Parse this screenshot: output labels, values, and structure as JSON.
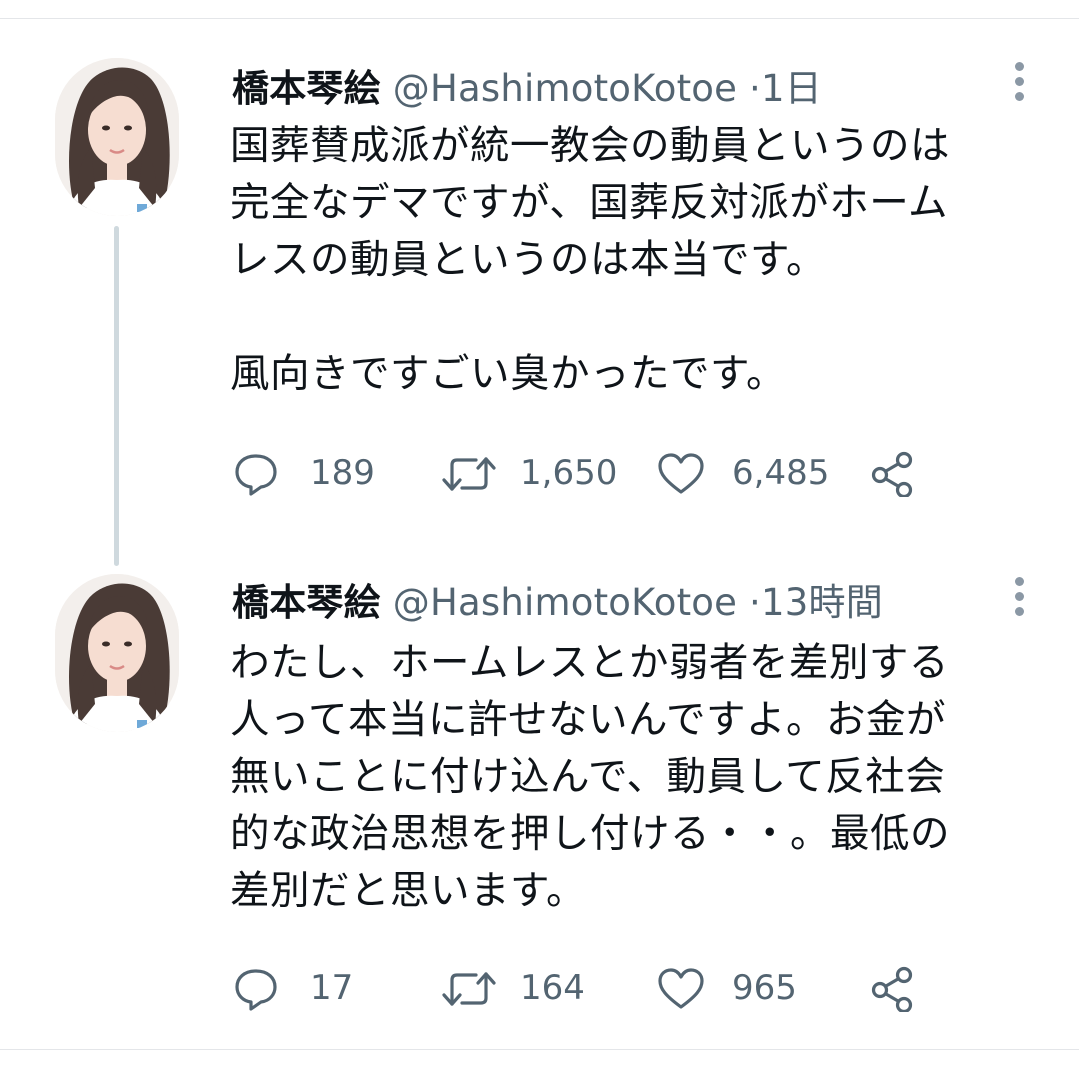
{
  "tweets": [
    {
      "author_name": "橋本琴絵",
      "handle": "@HashimotoKotoe",
      "separator": "·",
      "time": "1日",
      "text": "国葬賛成派が統一教会の動員というのは\n完全なデマですが、国葬反対派がホーム\nレスの動員というのは本当です。\n\n風向きですごい臭かったです。",
      "replies": "189",
      "retweets": "1,650",
      "likes": "6,485",
      "icons": {
        "more": "more-vertical-icon",
        "reply": "reply-icon",
        "retweet": "retweet-icon",
        "like": "heart-icon",
        "share": "share-icon"
      }
    },
    {
      "author_name": "橋本琴絵",
      "handle": "@HashimotoKotoe",
      "separator": "·",
      "time": "13時間",
      "text": "わたし、ホームレスとか弱者を差別する\n人って本当に許せないんですよ。お金が\n無いことに付け込んで、動員して反社会\n的な政治思想を押し付ける・・。最低の\n差別だと思います。",
      "replies": "17",
      "retweets": "164",
      "likes": "965",
      "icons": {
        "more": "more-vertical-icon",
        "reply": "reply-icon",
        "retweet": "retweet-icon",
        "like": "heart-icon",
        "share": "share-icon"
      }
    }
  ],
  "colors": {
    "text_primary": "#0f1419",
    "text_secondary": "#536471",
    "thread_line": "#cfd9de",
    "divider": "#e4e6e9"
  }
}
